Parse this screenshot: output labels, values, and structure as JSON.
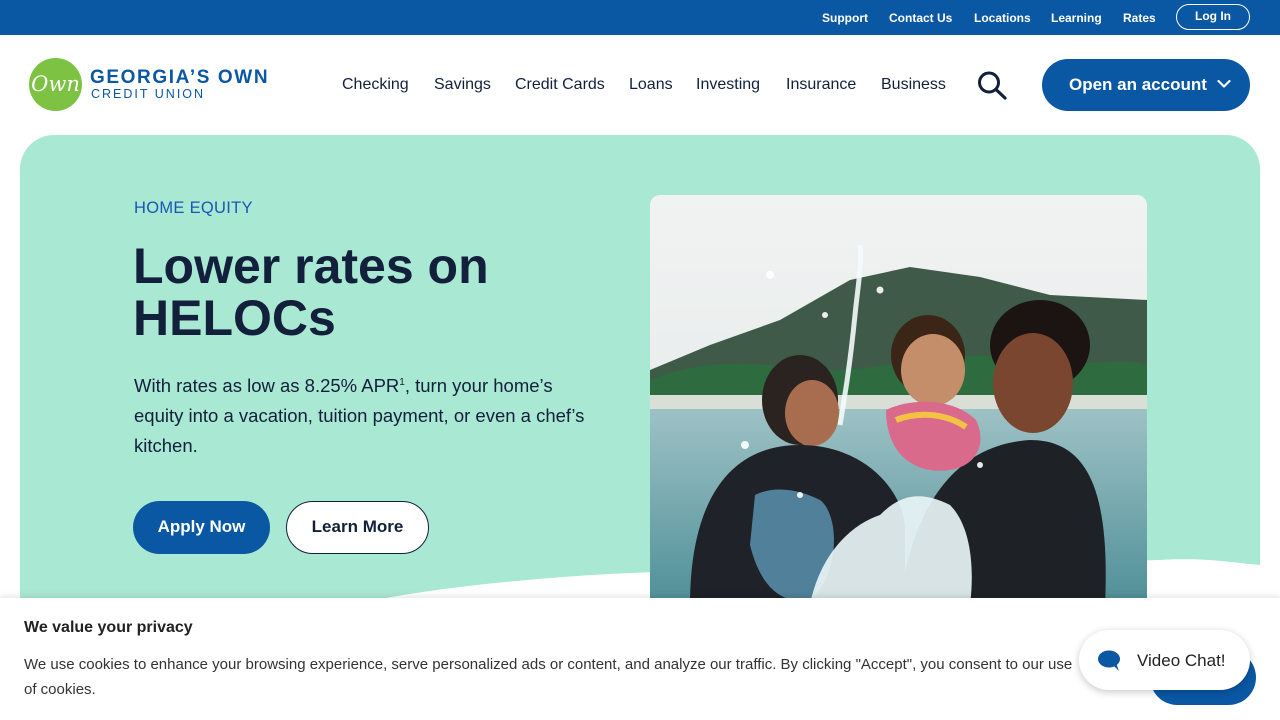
{
  "utility_nav": {
    "links": [
      "Support",
      "Contact Us",
      "Locations",
      "Learning",
      "Rates"
    ],
    "login_label": "Log In"
  },
  "brand": {
    "mark": "Own",
    "name": "GEORGIA’S OWN",
    "subname": "CREDIT UNION",
    "colors": {
      "primary": "#0a57a4",
      "logo_green": "#7dc242",
      "hero_mint": "#a9e8d2"
    }
  },
  "main_nav": {
    "links": [
      "Checking",
      "Savings",
      "Credit Cards",
      "Loans",
      "Investing",
      "Insurance",
      "Business"
    ],
    "search_icon": "search-icon",
    "open_account_label": "Open an account",
    "open_account_icon": "chevron-down-icon"
  },
  "hero": {
    "eyebrow": "HOME EQUITY",
    "headline": "Lower rates on HELOCs",
    "body_before": "With rates as low as 8.25% APR",
    "footnote": "1",
    "body_after": ", turn your home’s equity into a vacation, tuition payment, or even a chef’s kitchen.",
    "apply_label": "Apply Now",
    "learn_label": "Learn More"
  },
  "cookie_banner": {
    "title": "We value your privacy",
    "text": "We use cookies to enhance your browsing experience, serve personalized ads or content, and analyze our traffic. By clicking \"Accept\", you consent to our use of cookies."
  },
  "video_chat": {
    "label": "Video Chat!",
    "icon": "chat-bubble-icon"
  }
}
